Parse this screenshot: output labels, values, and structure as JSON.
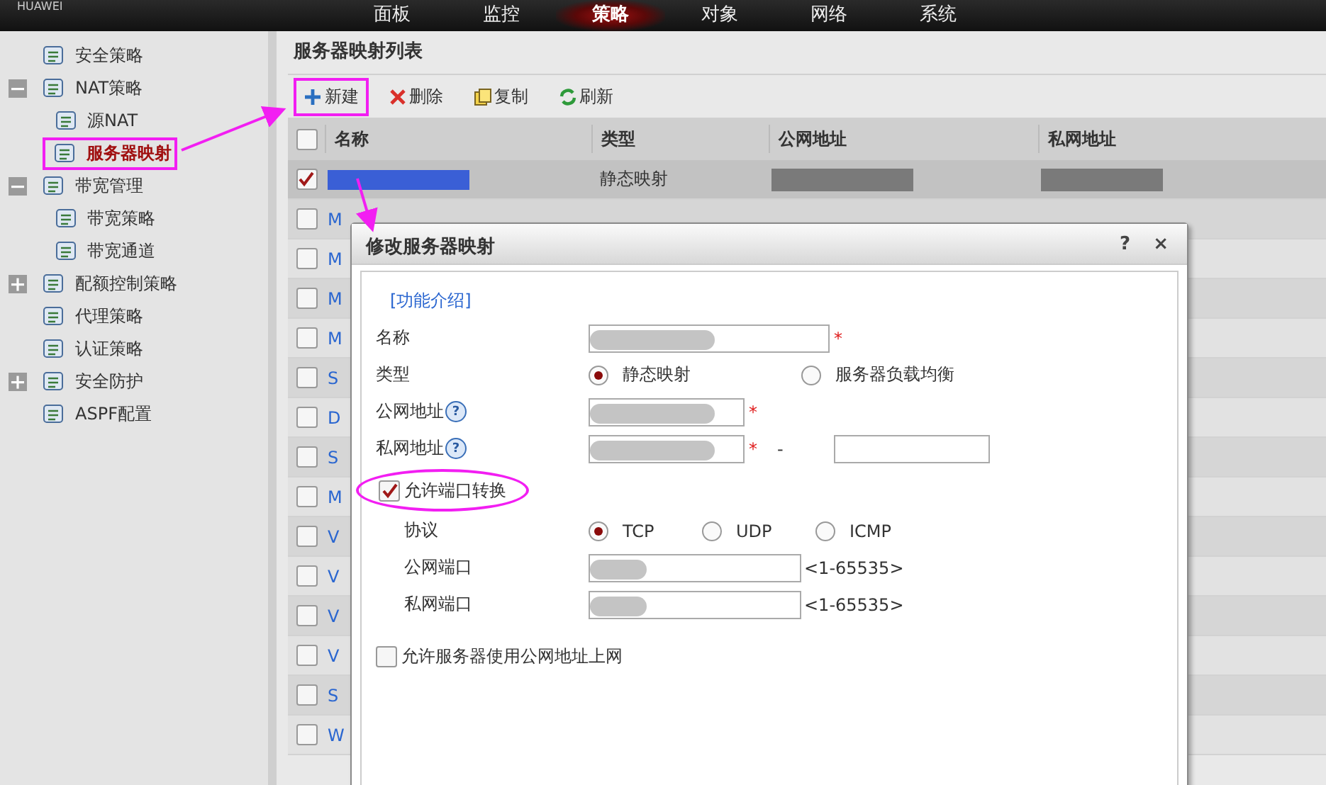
{
  "top_nav": {
    "brand": "HUAWEI",
    "items": [
      {
        "label": "面板",
        "selected": false
      },
      {
        "label": "监控",
        "selected": false
      },
      {
        "label": "策略",
        "selected": true
      },
      {
        "label": "对象",
        "selected": false
      },
      {
        "label": "网络",
        "selected": false
      },
      {
        "label": "系统",
        "selected": false
      }
    ]
  },
  "sidebar": {
    "items": [
      {
        "label": "安全策略",
        "selected": false
      },
      {
        "label": "NAT策略",
        "selected": false,
        "expanded": true,
        "children": [
          {
            "label": "源NAT",
            "selected": false
          },
          {
            "label": "服务器映射",
            "selected": true
          }
        ]
      },
      {
        "label": "带宽管理",
        "selected": false,
        "expanded": true,
        "children": [
          {
            "label": "带宽策略",
            "selected": false
          },
          {
            "label": "带宽通道",
            "selected": false
          }
        ]
      },
      {
        "label": "配额控制策略",
        "selected": false,
        "expanded": false
      },
      {
        "label": "代理策略",
        "selected": false
      },
      {
        "label": "认证策略",
        "selected": false
      },
      {
        "label": "安全防护",
        "selected": false,
        "expanded": false
      },
      {
        "label": "ASPF配置",
        "selected": false
      }
    ]
  },
  "panel": {
    "title": "服务器映射列表",
    "toolbar": [
      {
        "label": "新建",
        "kind": "add"
      },
      {
        "label": "删除",
        "kind": "delete"
      },
      {
        "label": "复制",
        "kind": "copy"
      },
      {
        "label": "刷新",
        "kind": "refresh"
      }
    ],
    "table": {
      "select_all": {
        "checked": false
      },
      "columns": [
        "名称",
        "类型",
        "公网地址",
        "私网地址"
      ],
      "rows": [
        {
          "checked": true,
          "redacted": true,
          "type": "静态映射"
        },
        {
          "checked": false,
          "name": "M"
        },
        {
          "checked": false,
          "name": "M"
        },
        {
          "checked": false,
          "name": "M"
        },
        {
          "checked": false,
          "name": "M"
        },
        {
          "checked": false,
          "name": "S"
        },
        {
          "checked": false,
          "name": "D"
        },
        {
          "checked": false,
          "name": "S"
        },
        {
          "checked": false,
          "name": "M"
        },
        {
          "checked": false,
          "name": "V"
        },
        {
          "checked": false,
          "name": "V"
        },
        {
          "checked": false,
          "name": "V"
        },
        {
          "checked": false,
          "name": "V"
        },
        {
          "checked": false,
          "name": "S"
        },
        {
          "checked": false,
          "name": "W"
        }
      ]
    }
  },
  "dialog": {
    "title": "修改服务器映射",
    "help": "?",
    "close": "×",
    "link": "[功能介绍]",
    "name": {
      "label": "名称",
      "required": "*",
      "redacted": true
    },
    "type": {
      "label": "类型",
      "options": [
        {
          "label": "静态映射",
          "selected": true
        },
        {
          "label": "服务器负载均衡",
          "selected": false
        }
      ]
    },
    "public_address": {
      "label": "公网地址",
      "required": "*",
      "redacted": true
    },
    "private_address": {
      "label": "私网地址",
      "required": "*",
      "redacted": true,
      "separator": "-"
    },
    "port_translation": {
      "label": "允许端口转换",
      "checked": true
    },
    "protocol": {
      "label": "协议",
      "options": [
        {
          "label": "TCP",
          "selected": true
        },
        {
          "label": "UDP",
          "selected": false
        },
        {
          "label": "ICMP",
          "selected": false
        }
      ]
    },
    "public_port": {
      "label": "公网端口",
      "redacted": true,
      "hint": "<1-65535>"
    },
    "private_port": {
      "label": "私网端口",
      "redacted": true,
      "hint": "<1-65535>"
    },
    "allow_public": {
      "label": "允许服务器使用公网地址上网",
      "checked": false
    }
  }
}
